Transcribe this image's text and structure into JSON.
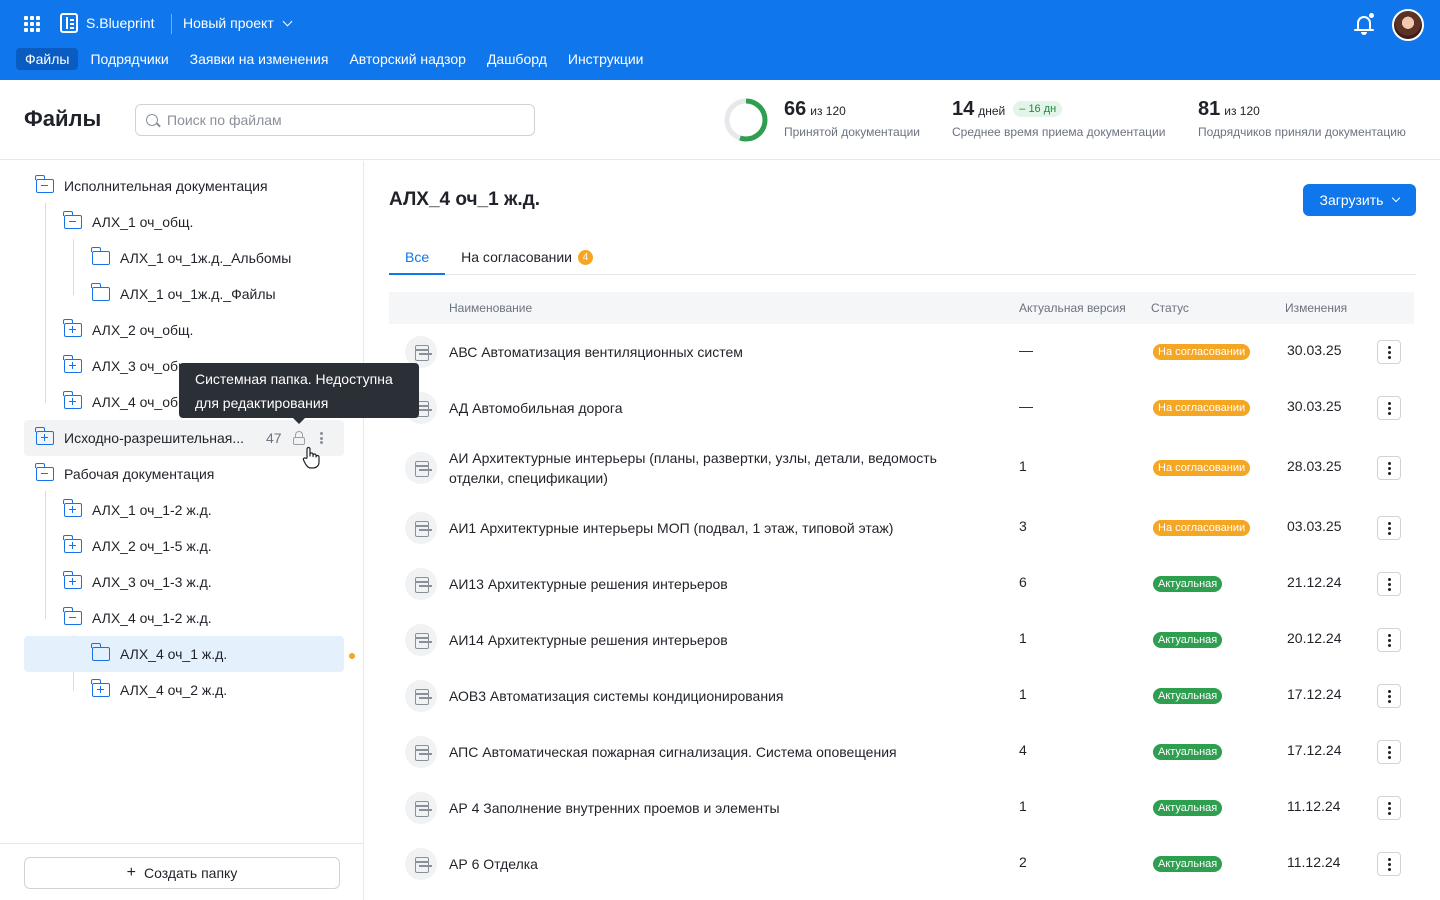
{
  "topbar": {
    "brand": "S.Blueprint",
    "project": "Новый проект",
    "nav": [
      "Файлы",
      "Подрядчики",
      "Заявки на изменения",
      "Авторский надзор",
      "Дашборд",
      "Инструкции"
    ],
    "accent": "#0f76ec"
  },
  "header": {
    "title": "Файлы",
    "search_placeholder": "Поиск по файлам",
    "progress_fraction": 0.55,
    "stats": [
      {
        "value": "66",
        "of": "из 120",
        "caption": "Принятой документации"
      },
      {
        "value": "14",
        "of": "дней",
        "delta": "– 16 дн",
        "caption": "Среднее время приема документации"
      },
      {
        "value": "81",
        "of": "из 120",
        "caption": "Подрядчиков приняли документацию"
      }
    ]
  },
  "sidebar": {
    "tree": [
      {
        "label": "Исполнительная документация",
        "icon": "folder-minus-icon"
      },
      {
        "label": "АЛХ_1 оч_общ.",
        "icon": "folder-minus-icon"
      },
      {
        "label": "АЛХ_1 оч_1ж.д._Альбомы",
        "icon": "folder-icon"
      },
      {
        "label": "АЛХ_1 оч_1ж.д._Файлы",
        "icon": "folder-icon"
      },
      {
        "label": "АЛХ_2 оч_общ.",
        "icon": "folder-plus-icon"
      },
      {
        "label": "АЛХ_3 оч_общ.",
        "icon": "folder-plus-icon"
      },
      {
        "label": "АЛХ_4 оч_общ.",
        "icon": "folder-plus-icon"
      },
      {
        "label": "Исходно-разрешительная...",
        "icon": "folder-plus-icon",
        "count": "47"
      },
      {
        "label": "Рабочая документация",
        "icon": "folder-minus-icon"
      },
      {
        "label": "АЛХ_1 оч_1-2 ж.д.",
        "icon": "folder-plus-icon"
      },
      {
        "label": "АЛХ_2 оч_1-5 ж.д.",
        "icon": "folder-plus-icon"
      },
      {
        "label": "АЛХ_3 оч_1-3 ж.д.",
        "icon": "folder-plus-icon"
      },
      {
        "label": "АЛХ_4 оч_1-2 ж.д.",
        "icon": "folder-minus-icon"
      },
      {
        "label": "АЛХ_4 оч_1 ж.д.",
        "icon": "folder-icon"
      },
      {
        "label": "АЛХ_4 оч_2 ж.д.",
        "icon": "folder-plus-icon"
      }
    ],
    "tooltip": "Системная папка. Недоступна для редактирования",
    "create_folder": "Создать папку"
  },
  "main": {
    "folder_title": "АЛХ_4 оч_1 ж.д.",
    "upload_label": "Загрузить",
    "tabs": [
      {
        "label": "Все"
      },
      {
        "label": "На согласовании",
        "badge": "4"
      }
    ],
    "columns": [
      "Наименование",
      "Актуальная версия",
      "Статус",
      "Изменения"
    ],
    "rows": [
      {
        "name": "АВС Автоматизация вентиляционных систем",
        "version": "—",
        "status": "На согласовании",
        "date": "30.03.25"
      },
      {
        "name": "АД Автомобильная дорога",
        "version": "—",
        "status": "На согласовании",
        "date": "30.03.25"
      },
      {
        "name": "АИ Архитектурные интерьеры (планы, развертки, узлы, детали, ведомость отделки, спецификации)",
        "version": "1",
        "status": "На согласовании",
        "date": "28.03.25"
      },
      {
        "name": "АИ1 Архитектурные интерьеры МОП (подвал, 1 этаж, типовой этаж)",
        "version": "3",
        "status": "На согласовании",
        "date": "03.03.25"
      },
      {
        "name": "АИ13 Архитектурные решения интерьеров",
        "version": "6",
        "status": "Актуальная",
        "date": "21.12.24"
      },
      {
        "name": "АИ14 Архитектурные решения интерьеров",
        "version": "1",
        "status": "Актуальная",
        "date": "20.12.24"
      },
      {
        "name": "АОВ3 Автоматизация системы кондиционирования",
        "version": "1",
        "status": "Актуальная",
        "date": "17.12.24"
      },
      {
        "name": "АПС Автоматическая пожарная сигнализация. Система оповещения",
        "version": "4",
        "status": "Актуальная",
        "date": "17.12.24"
      },
      {
        "name": "АР 4 Заполнение внутренних проемов и элементы",
        "version": "1",
        "status": "Актуальная",
        "date": "11.12.24"
      },
      {
        "name": "АР 6 Отделка",
        "version": "2",
        "status": "Актуальная",
        "date": "11.12.24"
      }
    ],
    "status_colors": {
      "pending": "#f5a623",
      "actual": "#2e9e4f"
    }
  }
}
